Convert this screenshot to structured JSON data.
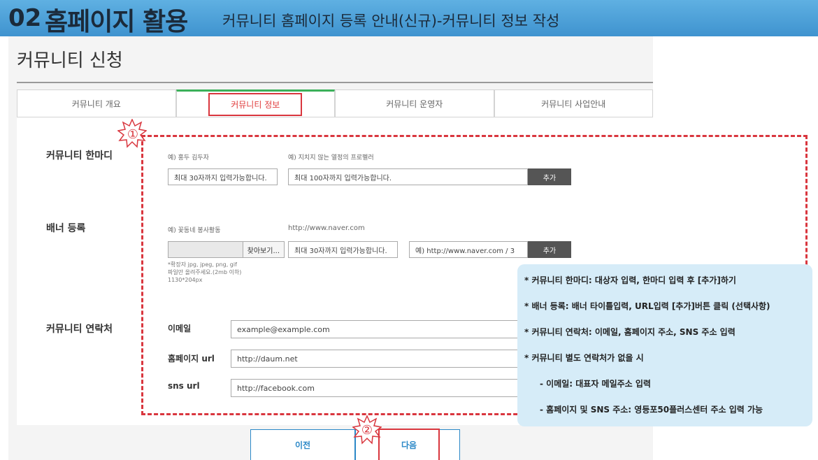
{
  "banner": {
    "number": "02",
    "title": "홈페이지 활용",
    "subtitle": "커뮤니티 홈페이지 등록 안내(신규)-커뮤니티 정보 작성"
  },
  "page": {
    "title": "커뮤니티 신청"
  },
  "tabs": [
    {
      "label": "커뮤니티 개요",
      "active": false
    },
    {
      "label": "커뮤니티 정보",
      "active": true
    },
    {
      "label": "커뮤니티 운영자",
      "active": false
    },
    {
      "label": "커뮤니티 사업안내",
      "active": false
    }
  ],
  "hanmadi": {
    "label": "커뮤니티 한마디",
    "hint_target": "예) 홍두 김두자",
    "hint_phrase": "예) 지치지 않는 열정의 프로펠러",
    "target_placeholder": "최대 30자까지 입력가능합니다.",
    "phrase_placeholder": "최대 100자까지 입력가능합니다.",
    "add_label": "추가"
  },
  "banner_reg": {
    "label": "배너 등록",
    "hint_title": "예) 꽃동네 봉사활동",
    "hint_url": "http://www.naver.com",
    "browse_label": "찾아보기...",
    "title_placeholder": "최대 30자까지 입력가능합니다.",
    "url_placeholder": "예) http://www.naver.com / 3",
    "add_label": "추가",
    "file_note_1": "*확장자 jpg, jpeg, png, gif",
    "file_note_2": "파일만 올려주세요.(2mb 이하)",
    "file_note_3": "1130*204px"
  },
  "contact": {
    "label": "커뮤니티 연락처",
    "email_label": "이메일",
    "email_placeholder": "example@example.com",
    "homepage_label": "홈페이지 url",
    "homepage_placeholder": "http://daum.net",
    "sns_label": "sns url",
    "sns_placeholder": "http://facebook.com"
  },
  "markers": {
    "one": "①",
    "two": "②"
  },
  "callout": {
    "line1": "* 커뮤니티 한마디: 대상자 입력, 한마디 입력 후 [추가]하기",
    "line2": "* 배너 등록: 배너 타이틀입력, URL입력 [추가]버튼 클릭 (선택사항)",
    "line3": "* 커뮤니티 연락처: 이메일, 홈페이지 주소, SNS 주소 입력",
    "line4": "* 커뮤니티 별도 연락처가 없을 시",
    "line5": "- 이메일: 대표자 메일주소 입력",
    "line6": "- 홈페이지 및 SNS 주소: 영등포50플러스센터 주소 입력 가능"
  },
  "nav": {
    "prev_label": "이전",
    "next_label": "다음"
  },
  "colors": {
    "banner_blue": "#4ea3da",
    "highlight_red": "#d9363e",
    "active_tab_green": "#3bb05a",
    "callout_bg": "#d6ecf8",
    "link_blue": "#2b88c7"
  }
}
